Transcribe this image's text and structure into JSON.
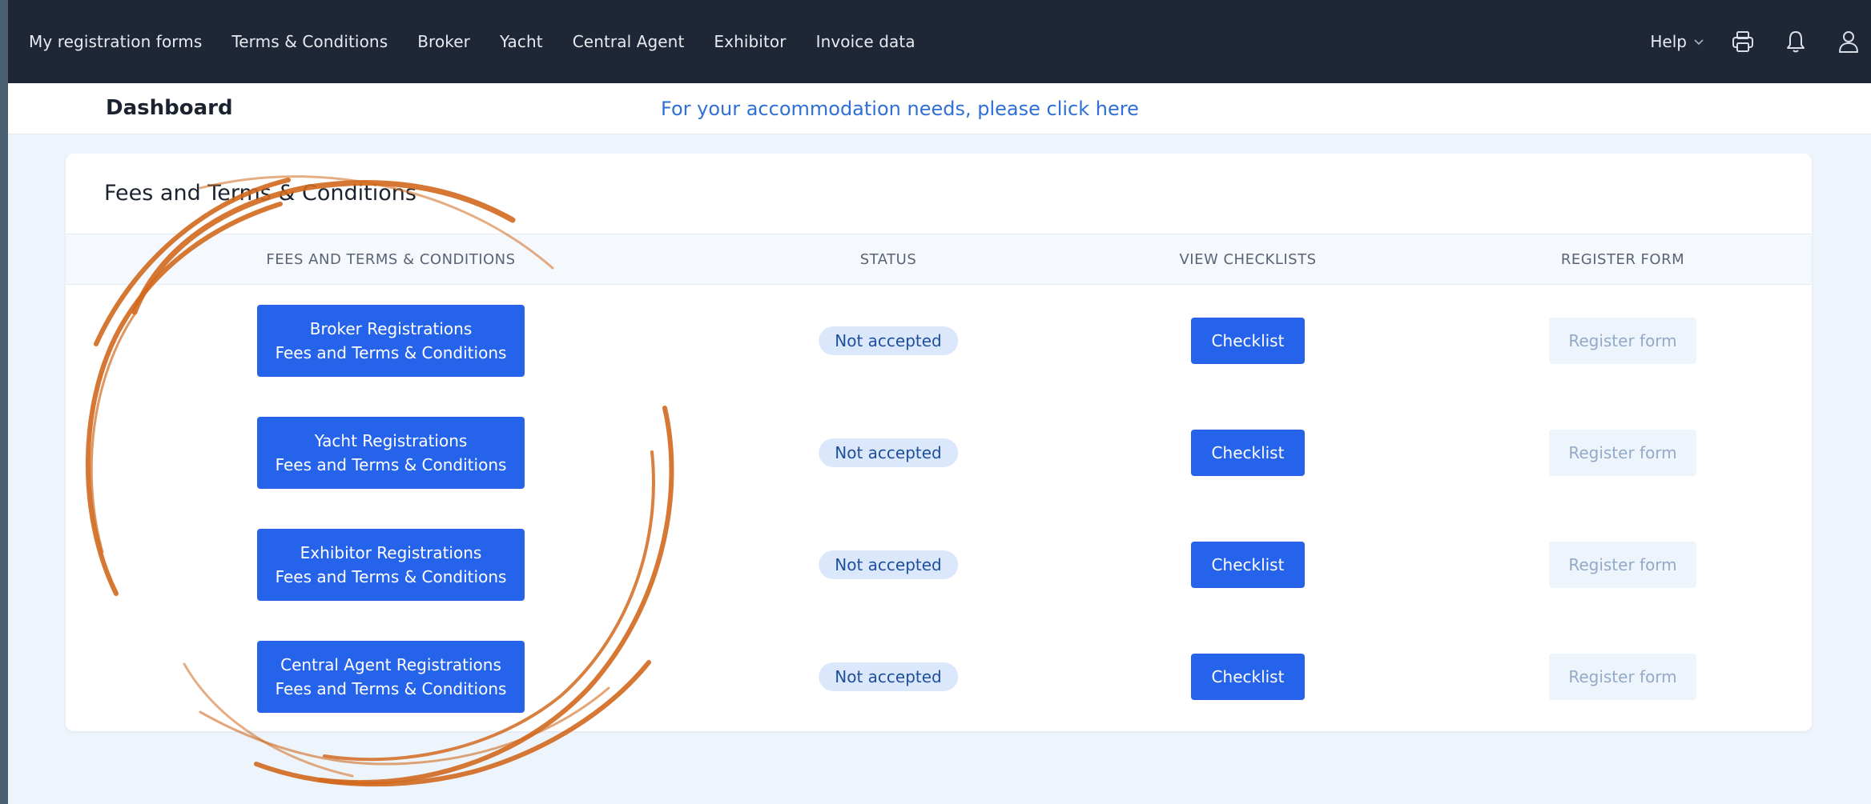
{
  "nav": {
    "links": [
      "My registration forms",
      "Terms & Conditions",
      "Broker",
      "Yacht",
      "Central Agent",
      "Exhibitor",
      "Invoice data"
    ],
    "help_label": "Help",
    "icons": [
      "printer-icon",
      "bell-icon",
      "user-icon"
    ]
  },
  "subheader": {
    "title": "Dashboard",
    "accommodation_link": "For your accommodation needs, please click here"
  },
  "card": {
    "title": "Fees and Terms & Conditions",
    "columns": [
      "FEES AND TERMS & CONDITIONS",
      "STATUS",
      "VIEW CHECKLISTS",
      "REGISTER FORM"
    ],
    "rows": [
      {
        "line1": "Broker Registrations",
        "line2": "Fees and Terms & Conditions",
        "status": "Not accepted",
        "checklist": "Checklist",
        "register": "Register form"
      },
      {
        "line1": "Yacht Registrations",
        "line2": "Fees and Terms & Conditions",
        "status": "Not accepted",
        "checklist": "Checklist",
        "register": "Register form"
      },
      {
        "line1": "Exhibitor Registrations",
        "line2": "Fees and Terms & Conditions",
        "status": "Not accepted",
        "checklist": "Checklist",
        "register": "Register form"
      },
      {
        "line1": "Central Agent Registrations",
        "line2": "Fees and Terms & Conditions",
        "status": "Not accepted",
        "checklist": "Checklist",
        "register": "Register form"
      }
    ]
  },
  "colors": {
    "navbar": "#1f2635",
    "primary": "#2563eb",
    "badge_bg": "#dbe8fb",
    "disabled_bg": "#eef4fb",
    "link": "#2f6fd6",
    "swirl": "#d2691e"
  }
}
